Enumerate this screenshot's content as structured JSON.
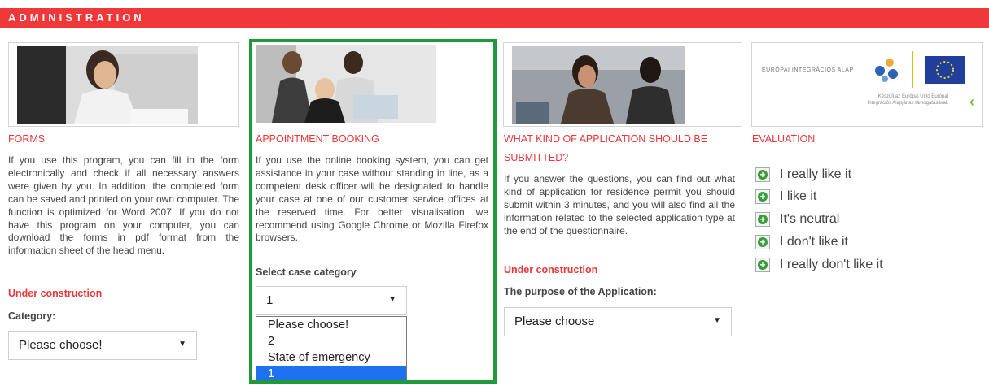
{
  "header": {
    "title": "ADMINISTRATION"
  },
  "forms": {
    "heading": "FORMS",
    "text": "If you use this program, you can fill in the form electronically and check if all necessary answers were given by you. In addition, the completed form can be saved and printed on your own computer. The function is optimized for Word 2007. If you do not have this program on your computer, you can download the forms in pdf format from the information sheet of the head menu.",
    "warning": "Under construction",
    "category_label": "Category:",
    "select_value": "Please choose!"
  },
  "booking": {
    "heading": "APPOINTMENT BOOKING",
    "text": "If you use the online booking system, you can get assistance in your case without standing in line, as a competent desk officer will be designated to handle your case at one of our customer service offices at the reserved time. For better visualisation, we recommend using Google Chrome or Mozilla Firefox browsers.",
    "select_label": "Select case category",
    "select_value": "1",
    "options": [
      "Please choose!",
      "2",
      "State of emergency",
      "1"
    ]
  },
  "application": {
    "heading_line1": "WHAT KIND OF APPLICATION SHOULD BE",
    "heading_line2": "SUBMITTED?",
    "text": "If you answer the questions, you can find out what kind of application for residence permit you should submit within 3 minutes, and you will also find all the information related to the selected application type at the end of the questionnaire.",
    "warning": "Under construction",
    "purpose_label": "The purpose of the Application:",
    "select_value": "Please choose"
  },
  "evaluation": {
    "heading": "EVALUATION",
    "logo_text": "EURÓPAI INTEGRÁCIÓS ALAP",
    "logo_subtext_1": "Készült az Európai Unió Európai",
    "logo_subtext_2": "Integrációs Alapjának támogatásával.",
    "options": [
      "I really like it",
      "I like it",
      "It's neutral",
      "I don't like it",
      "I really don't like it"
    ]
  },
  "colors": {
    "accent": "#f0383b",
    "highlight": "#1f9a3a",
    "selected": "#1e72f0"
  }
}
